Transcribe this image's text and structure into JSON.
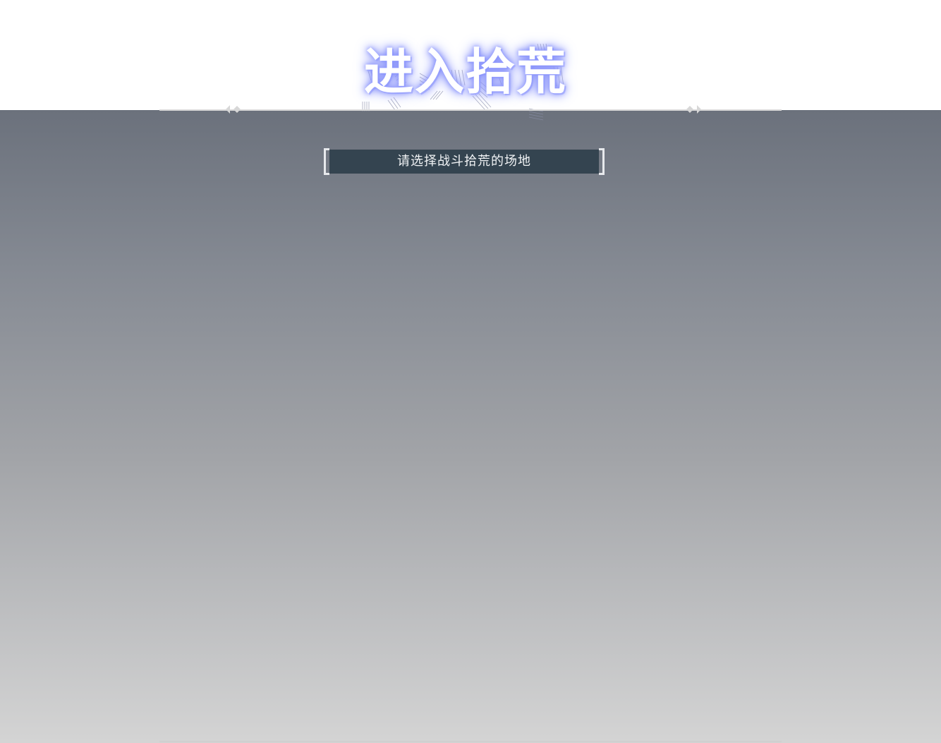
{
  "header": {
    "title": "进入拾荒"
  },
  "prompt": {
    "text": "请选择战斗拾荒的场地"
  },
  "colors": {
    "title_glow": "#8e98ff",
    "prompt_bg": "#344450",
    "panel_top": "#6b717c",
    "panel_bottom": "#d4d4d4",
    "divider": "#d8d8d8"
  },
  "icons": {
    "divider_left": "double-chevron-left-icon",
    "divider_right": "double-chevron-right-icon"
  }
}
